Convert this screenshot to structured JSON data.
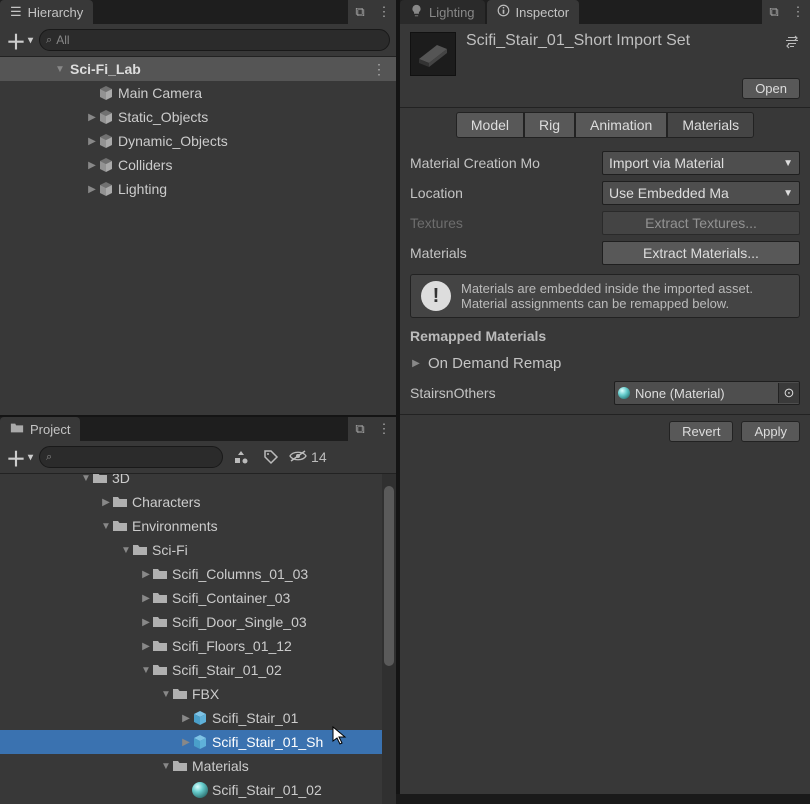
{
  "hierarchy": {
    "tab": "Hierarchy",
    "search_placeholder": "All",
    "scene": "Sci-Fi_Lab",
    "items": [
      {
        "name": "Main Camera",
        "depth": 2,
        "fold": "",
        "icon": "cube"
      },
      {
        "name": "Static_Objects",
        "depth": 2,
        "fold": "▶",
        "icon": "cube"
      },
      {
        "name": "Dynamic_Objects",
        "depth": 2,
        "fold": "▶",
        "icon": "cube"
      },
      {
        "name": "Colliders",
        "depth": 2,
        "fold": "▶",
        "icon": "cube"
      },
      {
        "name": "Lighting",
        "depth": 2,
        "fold": "▶",
        "icon": "cube"
      }
    ]
  },
  "project": {
    "tab": "Project",
    "hidden_count": "14",
    "items": [
      {
        "name": "3D",
        "depth": 2,
        "fold": "▼",
        "icon": "folder"
      },
      {
        "name": "Characters",
        "depth": 3,
        "fold": "▶",
        "icon": "folder"
      },
      {
        "name": "Environments",
        "depth": 3,
        "fold": "▼",
        "icon": "folder"
      },
      {
        "name": "Sci-Fi",
        "depth": 4,
        "fold": "▼",
        "icon": "folder"
      },
      {
        "name": "Scifi_Columns_01_03",
        "depth": 5,
        "fold": "▶",
        "icon": "folder"
      },
      {
        "name": "Scifi_Container_03",
        "depth": 5,
        "fold": "▶",
        "icon": "folder"
      },
      {
        "name": "Scifi_Door_Single_03",
        "depth": 5,
        "fold": "▶",
        "icon": "folder"
      },
      {
        "name": "Scifi_Floors_01_12",
        "depth": 5,
        "fold": "▶",
        "icon": "folder"
      },
      {
        "name": "Scifi_Stair_01_02",
        "depth": 5,
        "fold": "▼",
        "icon": "folder"
      },
      {
        "name": "FBX",
        "depth": 6,
        "fold": "▼",
        "icon": "folder"
      },
      {
        "name": "Scifi_Stair_01",
        "depth": 7,
        "fold": "▶",
        "icon": "prefab"
      },
      {
        "name": "Scifi_Stair_01_Sh",
        "depth": 7,
        "fold": "▶",
        "icon": "prefab",
        "sel": true
      },
      {
        "name": "Materials",
        "depth": 6,
        "fold": "▼",
        "icon": "folder"
      },
      {
        "name": "Scifi_Stair_01_02",
        "depth": 7,
        "fold": "",
        "icon": "mat"
      }
    ]
  },
  "inspector": {
    "tabs": {
      "lighting": "Lighting",
      "inspector": "Inspector"
    },
    "title": "Scifi_Stair_01_Short Import Set",
    "open": "Open",
    "subtabs": {
      "model": "Model",
      "rig": "Rig",
      "animation": "Animation",
      "materials": "Materials"
    },
    "mat_mode_label": "Material Creation Mo",
    "mat_mode_value": "Import via Material",
    "location_label": "Location",
    "location_value": "Use Embedded Ma",
    "textures_label": "Textures",
    "textures_btn": "Extract Textures...",
    "materials_label": "Materials",
    "materials_btn": "Extract Materials...",
    "msg": "Materials are embedded inside the imported asset. Material assignments can be remapped below.",
    "remapped": "Remapped Materials",
    "ondemand": "On Demand Remap",
    "slot_label": "StairsnOthers",
    "slot_value": "None (Material)",
    "revert": "Revert",
    "apply": "Apply"
  }
}
